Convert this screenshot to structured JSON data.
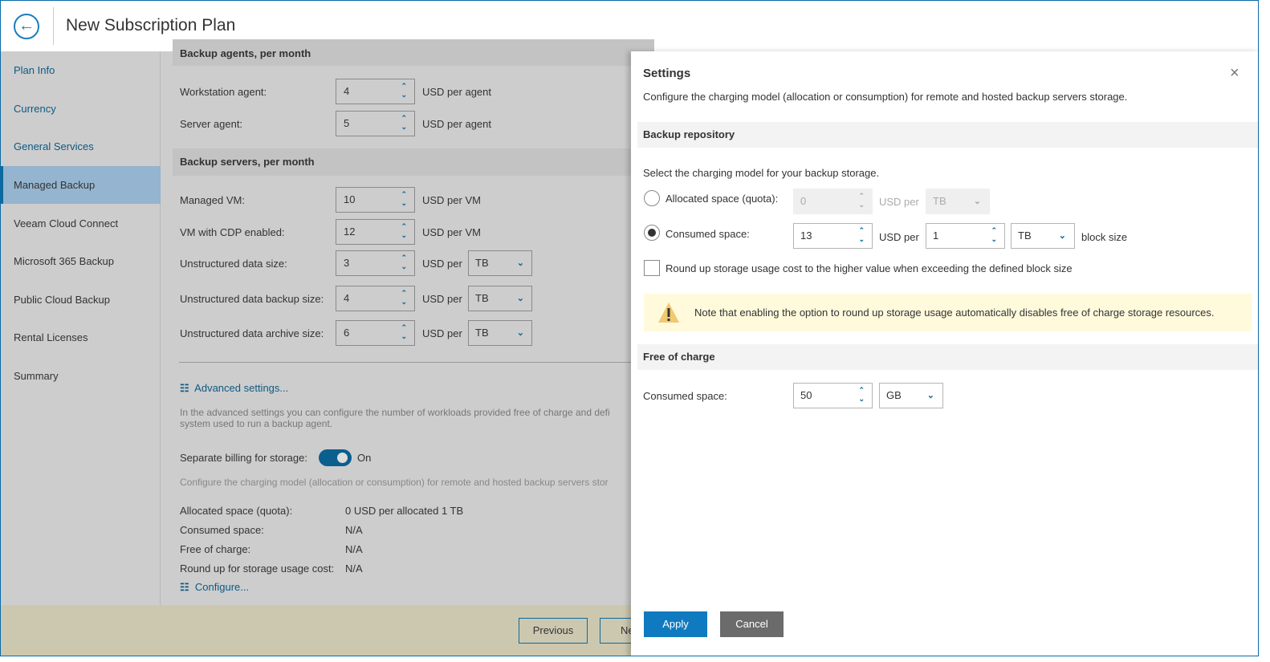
{
  "header": {
    "title": "New Subscription Plan",
    "back_icon": "arrow-left-circle-icon"
  },
  "sidebar": {
    "items": [
      {
        "label": "Plan Info"
      },
      {
        "label": "Currency"
      },
      {
        "label": "General Services"
      },
      {
        "label": "Managed Backup"
      },
      {
        "label": "Veeam Cloud Connect"
      },
      {
        "label": "Microsoft 365 Backup"
      },
      {
        "label": "Public Cloud Backup"
      },
      {
        "label": "Rental Licenses"
      },
      {
        "label": "Summary"
      }
    ]
  },
  "main": {
    "agents": {
      "title": "Backup agents, per month",
      "rows": [
        {
          "label": "Workstation agent:",
          "value": "4",
          "unit": "USD per agent"
        },
        {
          "label": "Server agent:",
          "value": "5",
          "unit": "USD per agent"
        }
      ]
    },
    "servers": {
      "title": "Backup servers, per month",
      "rows": [
        {
          "label": "Managed VM:",
          "value": "10",
          "unit": "USD per VM"
        },
        {
          "label": "VM with CDP enabled:",
          "value": "12",
          "unit": "USD per VM"
        },
        {
          "label": "Unstructured data size:",
          "value": "3",
          "unit": "USD per",
          "select": "TB"
        },
        {
          "label": "Unstructured data backup size:",
          "value": "4",
          "unit": "USD per",
          "select": "TB"
        },
        {
          "label": "Unstructured data archive size:",
          "value": "6",
          "unit": "USD per",
          "select": "TB"
        }
      ]
    },
    "advanced_link": "Advanced settings...",
    "advanced_desc": "In the advanced settings you can configure the number of workloads provided free of charge and defi",
    "advanced_desc2": "system used to run a backup agent.",
    "separate_label": "Separate billing for storage:",
    "separate_state": "On",
    "storage_desc": "Configure the charging model (allocation or consumption) for remote and hosted backup servers stor",
    "summary": [
      {
        "label": "Allocated space (quota):",
        "value": "0 USD per allocated 1 TB"
      },
      {
        "label": "Consumed space:",
        "value": "N/A"
      },
      {
        "label": "Free of charge:",
        "value": "N/A"
      },
      {
        "label": "Round up for storage usage cost:",
        "value": "N/A"
      }
    ],
    "configure_link": "Configure..."
  },
  "footer": {
    "previous": "Previous",
    "next": "Ne"
  },
  "panel": {
    "title": "Settings",
    "desc": "Configure the charging model (allocation or consumption) for remote and hosted backup servers storage.",
    "repo_title": "Backup repository",
    "select_prompt": "Select the charging model for your backup storage.",
    "allocated": {
      "label": "Allocated space (quota):",
      "value": "0",
      "unit": "USD per",
      "select": "TB"
    },
    "consumed": {
      "label": "Consumed space:",
      "value": "13",
      "unit": "USD per",
      "block": "1",
      "select": "TB",
      "suffix": "block size"
    },
    "roundup_label": "Round up storage usage cost to the higher value when exceeding the defined block size",
    "note": "Note that enabling the option to round up storage usage automatically disables free of charge storage resources.",
    "free_title": "Free of charge",
    "free": {
      "label": "Consumed space:",
      "value": "50",
      "select": "GB"
    },
    "apply": "Apply",
    "cancel": "Cancel"
  },
  "colors": {
    "accent": "#0f7ac0",
    "active_nav": "#94b4cf",
    "note_bg": "#fffadc"
  }
}
